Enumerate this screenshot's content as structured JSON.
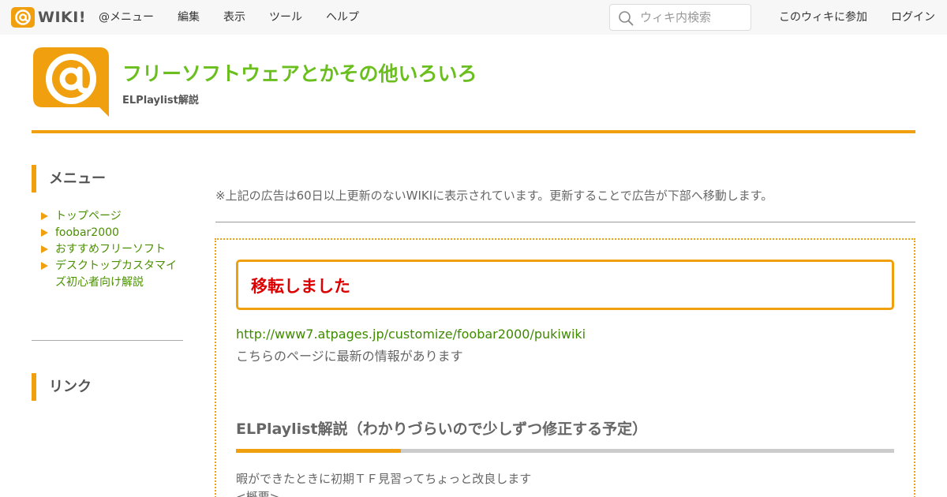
{
  "topbar": {
    "brand": "WIKI!",
    "nav": [
      "@メニュー",
      "編集",
      "表示",
      "ツール",
      "ヘルプ"
    ],
    "search_placeholder": "ウィキ内検索",
    "join_label": "このウィキに参加",
    "login_label": "ログイン"
  },
  "header": {
    "site_title": "フリーソフトウェアとかその他いろいろ",
    "page_name": "ELPlaylist解説"
  },
  "sidebar": {
    "menu_heading": "メニュー",
    "menu_items": [
      "トップページ",
      "foobar2000",
      "おすすめフリーソフト",
      "デスクトップカスタマイズ初心者向け解説"
    ],
    "link_heading": "リンク"
  },
  "main": {
    "ad_notice": "※上記の広告は60日以上更新のないWIKIに表示されています。更新することで広告が下部へ移動します。",
    "moved_heading": "移転しました",
    "moved_url": "http://www7.atpages.jp/customize/foobar2000/pukiwiki",
    "moved_note": "こちらのページに最新の情報があります",
    "section_title": "ELPlaylist解説（わかりづらいので少しずつ修正する予定）",
    "body_lines": [
      "暇ができたときに初期ＴＦ見習ってちょっと改良します",
      "<概要>"
    ]
  },
  "colors": {
    "accent": "#f0a00f",
    "title_green": "#6abf1f",
    "link_green": "#4a8f00",
    "alert_red": "#dd0000",
    "topbar_bg": "#f7f7f7"
  },
  "icons": {
    "brand": "at-mark-logo-icon",
    "search": "search-icon",
    "site_logo": "at-mark-speech-bubble-icon",
    "menu_bullet": "triangle-bullet-icon"
  }
}
